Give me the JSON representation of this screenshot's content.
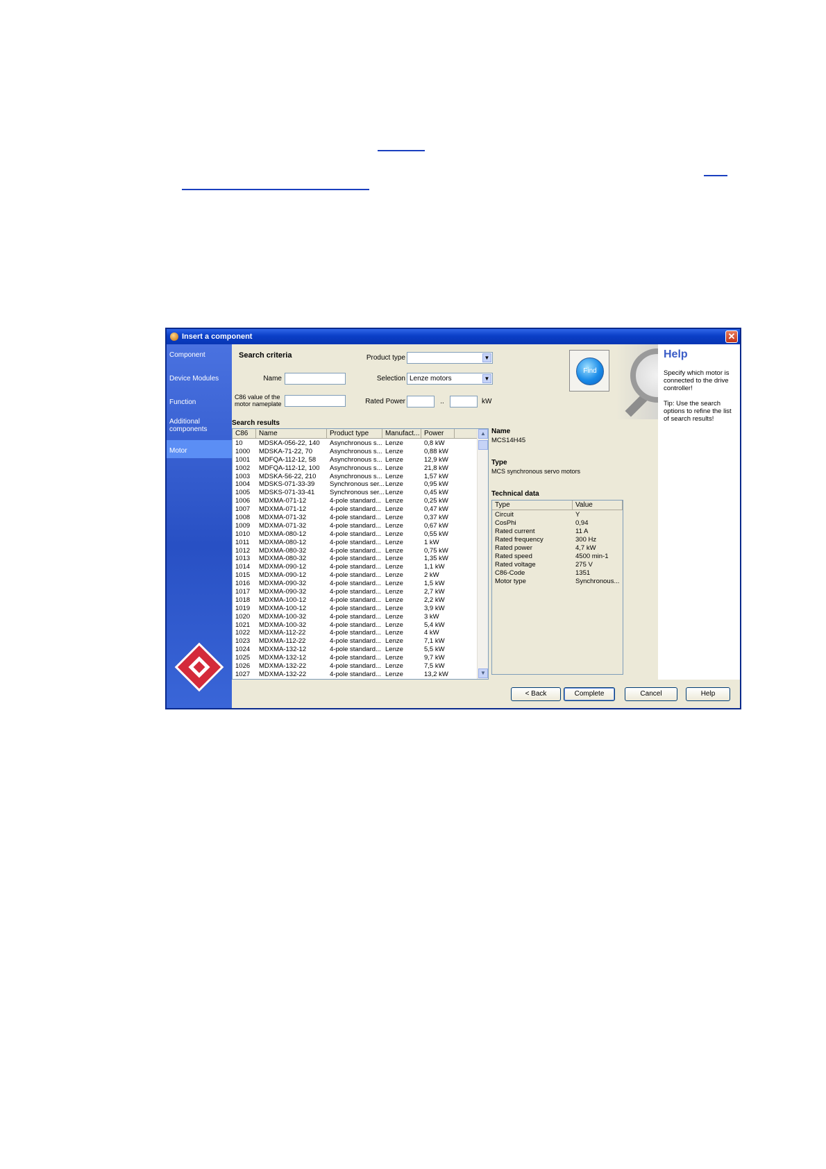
{
  "dialog": {
    "title": "Insert a component",
    "close_glyph": "✕"
  },
  "sidebar": {
    "items": [
      {
        "label": "Component"
      },
      {
        "label": "Device Modules"
      },
      {
        "label": "Function"
      },
      {
        "label": "Additional components"
      },
      {
        "label": "Motor"
      }
    ],
    "active": "Motor"
  },
  "criteria": {
    "title": "Search criteria",
    "product_type_label": "Product type",
    "product_type_value": "",
    "name_label": "Name",
    "name_value": "",
    "selection_label": "Selection",
    "selection_value": "Lenze motors",
    "c86_label": "C86 value of the motor nameplate",
    "c86_value": "",
    "rated_power_label": "Rated Power",
    "rated_power_sep": "..",
    "rated_power_unit": "kW",
    "find_label": "Find"
  },
  "results": {
    "title": "Search results",
    "columns": [
      "C86",
      "Name",
      "Product type",
      "Manufact...",
      "Power"
    ],
    "rows": [
      [
        "10",
        "MDSKA-056-22, 140",
        "Asynchronous s...",
        "Lenze",
        "0,8 kW"
      ],
      [
        "1000",
        "MDSKA-71-22, 70",
        "Asynchronous s...",
        "Lenze",
        "0,88 kW"
      ],
      [
        "1001",
        "MDFQA-112-12, 58",
        "Asynchronous s...",
        "Lenze",
        "12,9 kW"
      ],
      [
        "1002",
        "MDFQA-112-12, 100",
        "Asynchronous s...",
        "Lenze",
        "21,8 kW"
      ],
      [
        "1003",
        "MDSKA-56-22, 210",
        "Asynchronous s...",
        "Lenze",
        "1,57 kW"
      ],
      [
        "1004",
        "MDSKS-071-33-39",
        "Synchronous ser...",
        "Lenze",
        "0,95 kW"
      ],
      [
        "1005",
        "MDSKS-071-33-41",
        "Synchronous ser...",
        "Lenze",
        "0,45 kW"
      ],
      [
        "1006",
        "MDXMA-071-12",
        "4-pole standard...",
        "Lenze",
        "0,25 kW"
      ],
      [
        "1007",
        "MDXMA-071-12",
        "4-pole standard...",
        "Lenze",
        "0,47 kW"
      ],
      [
        "1008",
        "MDXMA-071-32",
        "4-pole standard...",
        "Lenze",
        "0,37 kW"
      ],
      [
        "1009",
        "MDXMA-071-32",
        "4-pole standard...",
        "Lenze",
        "0,67 kW"
      ],
      [
        "1010",
        "MDXMA-080-12",
        "4-pole standard...",
        "Lenze",
        "0,55 kW"
      ],
      [
        "1011",
        "MDXMA-080-12",
        "4-pole standard...",
        "Lenze",
        "1 kW"
      ],
      [
        "1012",
        "MDXMA-080-32",
        "4-pole standard...",
        "Lenze",
        "0,75 kW"
      ],
      [
        "1013",
        "MDXMA-080-32",
        "4-pole standard...",
        "Lenze",
        "1,35 kW"
      ],
      [
        "1014",
        "MDXMA-090-12",
        "4-pole standard...",
        "Lenze",
        "1,1 kW"
      ],
      [
        "1015",
        "MDXMA-090-12",
        "4-pole standard...",
        "Lenze",
        "2 kW"
      ],
      [
        "1016",
        "MDXMA-090-32",
        "4-pole standard...",
        "Lenze",
        "1,5 kW"
      ],
      [
        "1017",
        "MDXMA-090-32",
        "4-pole standard...",
        "Lenze",
        "2,7 kW"
      ],
      [
        "1018",
        "MDXMA-100-12",
        "4-pole standard...",
        "Lenze",
        "2,2 kW"
      ],
      [
        "1019",
        "MDXMA-100-12",
        "4-pole standard...",
        "Lenze",
        "3,9 kW"
      ],
      [
        "1020",
        "MDXMA-100-32",
        "4-pole standard...",
        "Lenze",
        "3 kW"
      ],
      [
        "1021",
        "MDXMA-100-32",
        "4-pole standard...",
        "Lenze",
        "5,4 kW"
      ],
      [
        "1022",
        "MDXMA-112-22",
        "4-pole standard...",
        "Lenze",
        "4 kW"
      ],
      [
        "1023",
        "MDXMA-112-22",
        "4-pole standard...",
        "Lenze",
        "7,1 kW"
      ],
      [
        "1024",
        "MDXMA-132-12",
        "4-pole standard...",
        "Lenze",
        "5,5 kW"
      ],
      [
        "1025",
        "MDXMA-132-12",
        "4-pole standard...",
        "Lenze",
        "9,7 kW"
      ],
      [
        "1026",
        "MDXMA-132-22",
        "4-pole standard...",
        "Lenze",
        "7,5 kW"
      ],
      [
        "1027",
        "MDXMA-132-22",
        "4-pole standard...",
        "Lenze",
        "13,2 kW"
      ]
    ]
  },
  "details": {
    "name_heading": "Name",
    "name_value": "MCS14H45",
    "type_heading": "Type",
    "type_value": "MCS synchronous servo motors",
    "tech_heading": "Technical data",
    "tech_columns": [
      "Type",
      "Value"
    ],
    "tech_rows": [
      [
        "Circuit",
        "Y"
      ],
      [
        "CosPhi",
        "0,94"
      ],
      [
        "Rated current",
        "11 A"
      ],
      [
        "Rated frequency",
        "300 Hz"
      ],
      [
        "Rated power",
        "4,7 kW"
      ],
      [
        "Rated speed",
        "4500 min-1"
      ],
      [
        "Rated voltage",
        "275 V"
      ],
      [
        "C86-Code",
        "1351"
      ],
      [
        "Motor type",
        "Synchronous..."
      ]
    ]
  },
  "help": {
    "title": "Help",
    "text1": "Specify which motor is connected to the drive controller!",
    "text2": "Tip: Use the search options to refine the list of search results!"
  },
  "buttons": {
    "back": "< Back",
    "complete": "Complete",
    "cancel": "Cancel",
    "help": "Help"
  },
  "colors": {
    "title_bar": "#0a3ec7",
    "sidebar": "#2850c4",
    "link_underline": "#1a3fbf",
    "logo_red": "#d42a3a"
  }
}
